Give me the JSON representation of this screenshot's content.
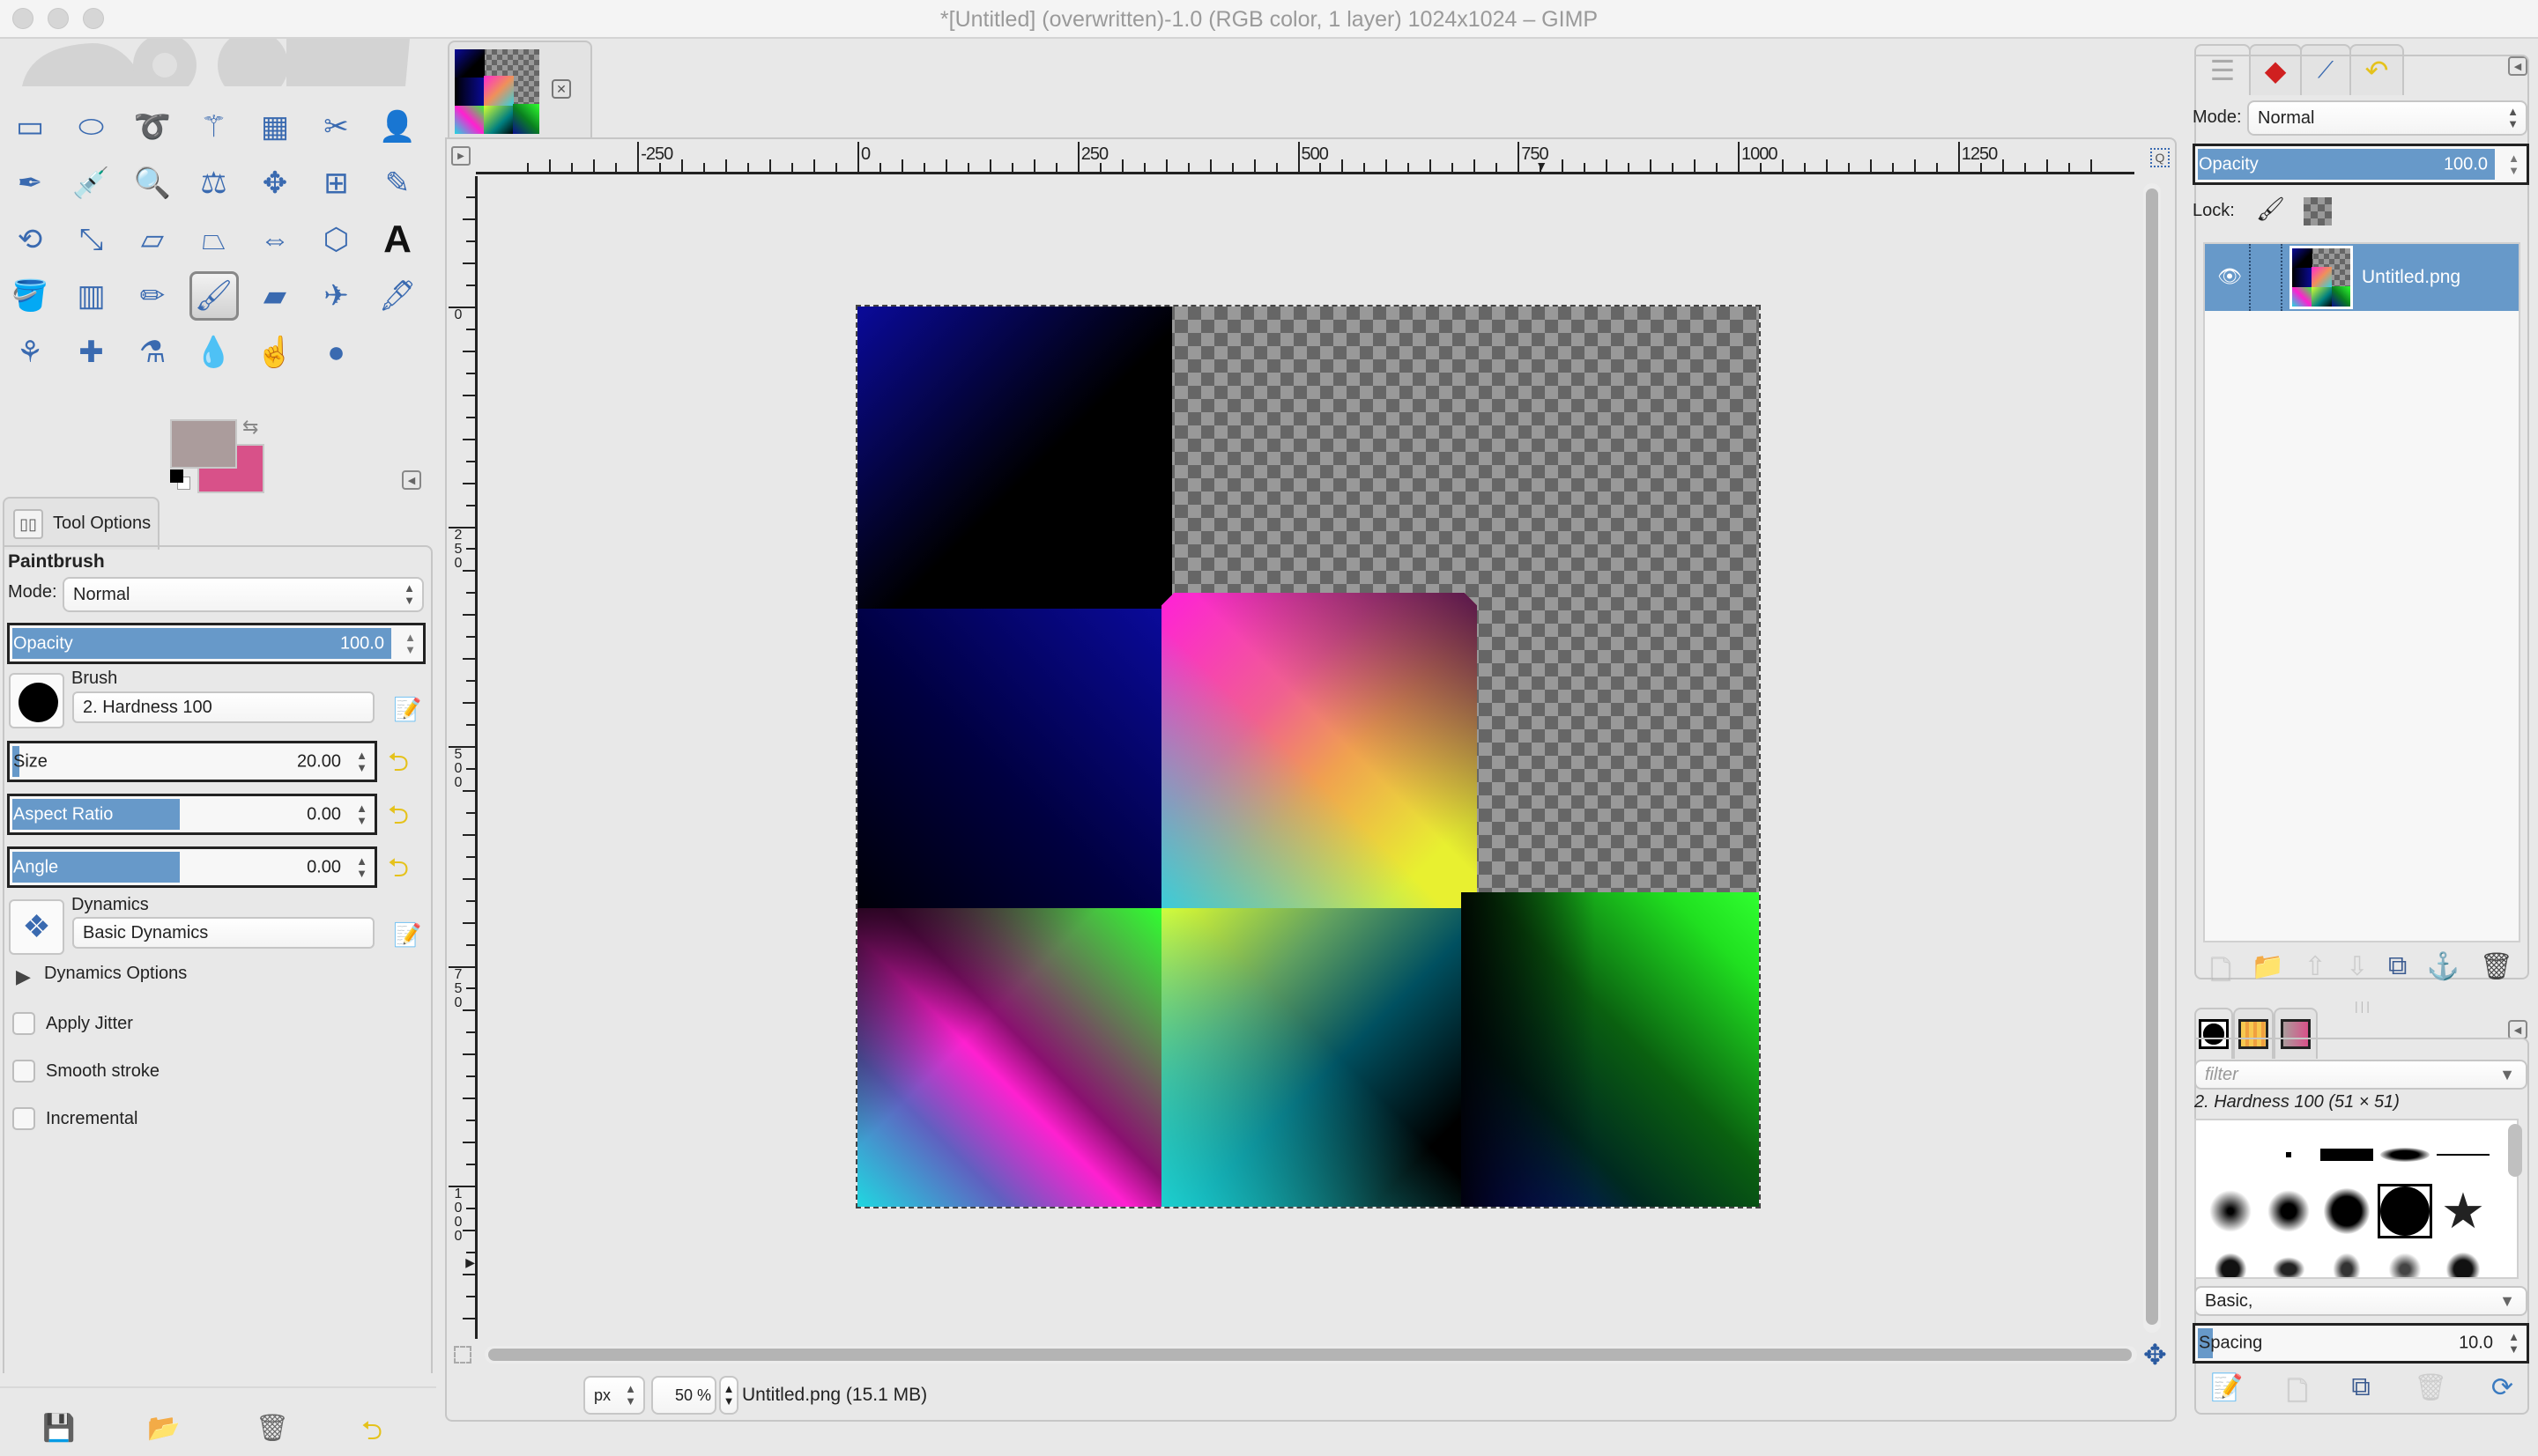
{
  "window": {
    "title": "*[Untitled] (overwritten)-1.0 (RGB color, 1 layer) 1024x1024 – GIMP"
  },
  "toolbox": {
    "tools": [
      {
        "name": "rect-select",
        "glyph": "▭"
      },
      {
        "name": "ellipse-select",
        "glyph": "⬭"
      },
      {
        "name": "free-select",
        "glyph": "➰"
      },
      {
        "name": "fuzzy-select",
        "glyph": "⚚"
      },
      {
        "name": "select-by-color",
        "glyph": "▦"
      },
      {
        "name": "scissors-select",
        "glyph": "✂"
      },
      {
        "name": "foreground-select",
        "glyph": "👤"
      },
      {
        "name": "paths",
        "glyph": "✒"
      },
      {
        "name": "color-picker",
        "glyph": "💉"
      },
      {
        "name": "zoom",
        "glyph": "🔍"
      },
      {
        "name": "measure",
        "glyph": "⚖"
      },
      {
        "name": "move",
        "glyph": "✥"
      },
      {
        "name": "align",
        "glyph": "⊞"
      },
      {
        "name": "crop",
        "glyph": "✎"
      },
      {
        "name": "rotate",
        "glyph": "⟲"
      },
      {
        "name": "scale",
        "glyph": "⤡"
      },
      {
        "name": "shear",
        "glyph": "▱"
      },
      {
        "name": "perspective",
        "glyph": "⏢"
      },
      {
        "name": "flip",
        "glyph": "⇔"
      },
      {
        "name": "cage-transform",
        "glyph": "⬡"
      },
      {
        "name": "text",
        "glyph": "A"
      },
      {
        "name": "bucket-fill",
        "glyph": "🪣"
      },
      {
        "name": "blend",
        "glyph": "▥"
      },
      {
        "name": "pencil",
        "glyph": "✏"
      },
      {
        "name": "paintbrush",
        "glyph": "🖌"
      },
      {
        "name": "eraser",
        "glyph": "▰"
      },
      {
        "name": "airbrush",
        "glyph": "✈"
      },
      {
        "name": "ink",
        "glyph": "🖋"
      },
      {
        "name": "clone",
        "glyph": "⚘"
      },
      {
        "name": "heal",
        "glyph": "✚"
      },
      {
        "name": "perspective-clone",
        "glyph": "⚗"
      },
      {
        "name": "blur-sharpen",
        "glyph": "💧"
      },
      {
        "name": "smudge",
        "glyph": "☝"
      },
      {
        "name": "dodge-burn",
        "glyph": "●"
      }
    ],
    "active_tool": "paintbrush",
    "fg_color": "#ab9c9c",
    "bg_color": "#d85189"
  },
  "tool_options": {
    "tab_label": "Tool Options",
    "tool_name": "Paintbrush",
    "mode_label": "Mode:",
    "mode_value": "Normal",
    "opacity_label": "Opacity",
    "opacity_value": "100.0",
    "opacity_fraction": 1.0,
    "brush_label": "Brush",
    "brush_value": "2. Hardness 100",
    "size_label": "Size",
    "size_value": "20.00",
    "size_fraction": 0.02,
    "aspect_label": "Aspect Ratio",
    "aspect_value": "0.00",
    "aspect_fraction": 0.5,
    "angle_label": "Angle",
    "angle_value": "0.00",
    "angle_fraction": 0.5,
    "dynamics_label": "Dynamics",
    "dynamics_value": "Basic Dynamics",
    "dynamics_options_label": "Dynamics Options",
    "checkboxes": [
      {
        "label": "Apply Jitter",
        "checked": false
      },
      {
        "label": "Smooth stroke",
        "checked": false
      },
      {
        "label": "Incremental",
        "checked": false
      }
    ],
    "footer_buttons": [
      "save-options",
      "restore-options",
      "delete-options",
      "reset-options"
    ]
  },
  "image_tab": {
    "close_glyph": "✕"
  },
  "rulers": {
    "h_labels": [
      "-250",
      "0",
      "250",
      "500",
      "750",
      "1000",
      "1250"
    ],
    "v_labels": [
      "0",
      "250",
      "500",
      "750",
      "1000"
    ]
  },
  "statusbar": {
    "unit": "px",
    "zoom": "50 %",
    "file_info": "Untitled.png (15.1 MB)"
  },
  "layers": {
    "tabs": [
      "layers",
      "channels",
      "paths",
      "undo-history"
    ],
    "mode_label": "Mode:",
    "mode_value": "Normal",
    "opacity_label": "Opacity",
    "opacity_value": "100.0",
    "lock_label": "Lock:",
    "items": [
      {
        "name": "Untitled.png",
        "visible": true,
        "selected": true
      }
    ],
    "buttons": [
      "new-layer",
      "new-layer-group",
      "raise-layer",
      "lower-layer",
      "duplicate-layer",
      "anchor-layer",
      "delete-layer"
    ]
  },
  "brushes": {
    "tabs": [
      "brushes",
      "patterns",
      "gradients"
    ],
    "filter_placeholder": "filter",
    "selected_label": "2. Hardness 100 (51 × 51)",
    "tag_value": "Basic,",
    "spacing_label": "Spacing",
    "spacing_value": "10.0",
    "spacing_fraction": 0.05,
    "buttons": [
      "edit-brush",
      "new-brush",
      "duplicate-brush",
      "delete-brush",
      "refresh-brushes"
    ]
  }
}
